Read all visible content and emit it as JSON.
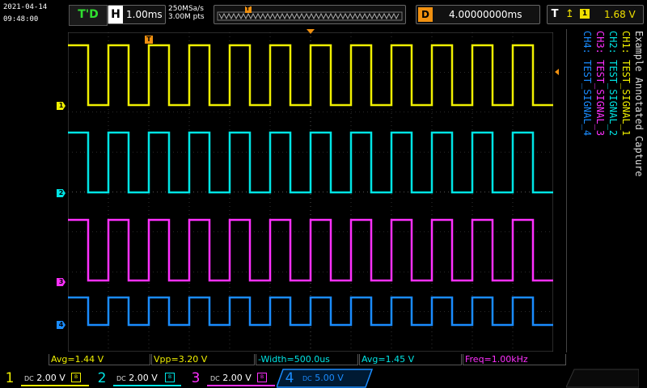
{
  "status_bar": {
    "date": "2021-04-14",
    "time": "09:48:00",
    "trigger_status": "T'D",
    "horizontal": {
      "label": "H",
      "timebase": "1.00ms"
    },
    "acquisition": {
      "sample_rate": "250MSa/s",
      "points": "3.00M pts"
    },
    "memory_trigger_marker": "T",
    "delay": {
      "label": "D",
      "value": "4.00000000ms"
    },
    "trigger": {
      "label": "T",
      "edge_icon": "rising-edge-icon",
      "source": "1",
      "level": "1.68 V"
    }
  },
  "waveform": {
    "period_divisions": 1,
    "timebase_ms_per_div": 1.0
  },
  "channel_markers": [
    {
      "label": "1",
      "color": "#f0f000"
    },
    {
      "label": "2",
      "color": "#00e5e5"
    },
    {
      "label": "3",
      "color": "#ff30ff"
    },
    {
      "label": "4",
      "color": "#1a8cff"
    }
  ],
  "annotation": {
    "title": "Example Annotated Capture",
    "lines": [
      {
        "text": "CH1: TEST_SIGNAL_1",
        "color": "#f0f000"
      },
      {
        "text": "CH2: TEST_SIGNAL_2",
        "color": "#00e5e5"
      },
      {
        "text": "CH3: TEST_SIGNAL_3",
        "color": "#ff30ff"
      },
      {
        "text": "CH4: TEST_SIGNAL_4",
        "color": "#1a8cff"
      }
    ]
  },
  "measurements": [
    {
      "text": "Avg=1.44 V",
      "color": "#f0f000"
    },
    {
      "text": "Vpp=3.20 V",
      "color": "#f0f000"
    },
    {
      "text": "-Width=500.0us",
      "color": "#00e5e5"
    },
    {
      "text": "Avg=1.45 V",
      "color": "#00e5e5"
    },
    {
      "text": "Freq=1.00kHz",
      "color": "#ff30ff"
    }
  ],
  "channels": [
    {
      "num": "1",
      "coupling": "DC",
      "scale": "2.00 V",
      "color": "#f0f000",
      "active": false
    },
    {
      "num": "2",
      "coupling": "DC",
      "scale": "2.00 V",
      "color": "#00e5e5",
      "active": false
    },
    {
      "num": "3",
      "coupling": "DC",
      "scale": "2.00 V",
      "color": "#ff30ff",
      "active": false
    },
    {
      "num": "4",
      "coupling": "DC",
      "scale": "5.00 V",
      "color": "#1a8cff",
      "active": true
    }
  ],
  "colors": {
    "grid": "#555555",
    "accent_orange": "#f09010"
  }
}
